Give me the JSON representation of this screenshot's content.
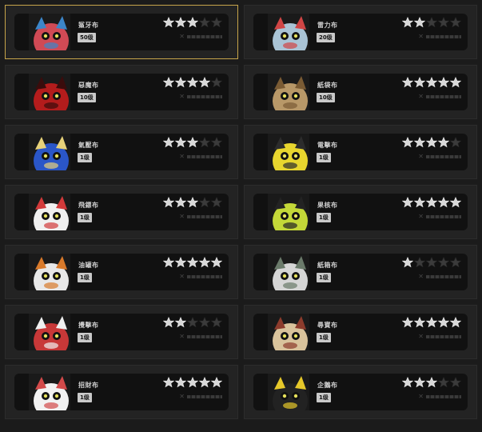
{
  "cards": [
    {
      "name": "鯊牙布",
      "level": "50级",
      "stars": 3,
      "body": "#d04a55",
      "accent": "#3c86c9",
      "selected": true
    },
    {
      "name": "雷力布",
      "level": "20级",
      "stars": 2,
      "body": "#aac4d6",
      "accent": "#d04545",
      "selected": false
    },
    {
      "name": "惡魔布",
      "level": "10级",
      "stars": 4,
      "body": "#b31c1c",
      "accent": "#3a0c0c",
      "selected": false
    },
    {
      "name": "紙袋布",
      "level": "10级",
      "stars": 5,
      "body": "#b89868",
      "accent": "#7a5b34",
      "selected": false
    },
    {
      "name": "氣壓布",
      "level": "1级",
      "stars": 3,
      "body": "#2a56c8",
      "accent": "#e8d27a",
      "selected": false
    },
    {
      "name": "電擊布",
      "level": "1级",
      "stars": 4,
      "body": "#e8d62e",
      "accent": "#2c2c2c",
      "selected": false
    },
    {
      "name": "飛鏢布",
      "level": "1级",
      "stars": 3,
      "body": "#f0f0f0",
      "accent": "#d23a3a",
      "selected": false
    },
    {
      "name": "果核布",
      "level": "1级",
      "stars": 5,
      "body": "#c4d838",
      "accent": "#232323",
      "selected": false
    },
    {
      "name": "油罐布",
      "level": "1级",
      "stars": 5,
      "body": "#e8e8e8",
      "accent": "#d97a2b",
      "selected": false
    },
    {
      "name": "紙箱布",
      "level": "1级",
      "stars": 1,
      "body": "#d6d6d6",
      "accent": "#6a7a6a",
      "selected": false
    },
    {
      "name": "攪擊布",
      "level": "1级",
      "stars": 2,
      "body": "#c83838",
      "accent": "#f0f0f0",
      "selected": false
    },
    {
      "name": "尋寶布",
      "level": "1级",
      "stars": 5,
      "body": "#d9c39c",
      "accent": "#8c3b2c",
      "selected": false
    },
    {
      "name": "招財布",
      "level": "1级",
      "stars": 5,
      "body": "#f2f2f2",
      "accent": "#d34a4a",
      "selected": false
    },
    {
      "name": "企鵝布",
      "level": "1级",
      "stars": 3,
      "body": "#222222",
      "accent": "#e6c82a",
      "selected": false
    }
  ]
}
